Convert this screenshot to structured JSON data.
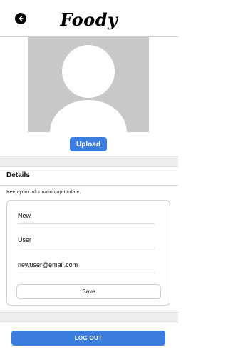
{
  "header": {
    "logo_text": "Foody",
    "back_icon": "back-arrow-icon"
  },
  "profile": {
    "avatar_icon": "default-avatar-icon",
    "upload_label": "Upload"
  },
  "details": {
    "title": "Details",
    "description": "Keep your information up-to-date.",
    "first_name": "New",
    "last_name": "User",
    "email": "newuser@email.com",
    "save_label": "Save"
  },
  "footer": {
    "logout_label": "LOG OUT"
  },
  "colors": {
    "accent": "#3b7ee0",
    "avatar_bg": "#c8c8c8",
    "band_bg": "#eeeeee"
  }
}
